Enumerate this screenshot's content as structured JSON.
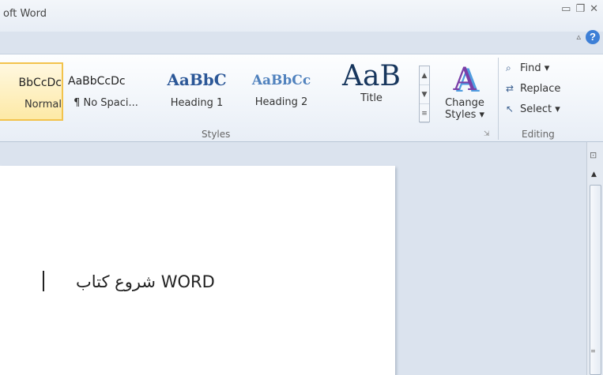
{
  "titlebar": {
    "title": "oft Word",
    "minimize": "▭",
    "restore": "❐",
    "close": "✕",
    "collapse_ribbon": "▵",
    "help": "?"
  },
  "styles": {
    "items": [
      {
        "sample": "BbCcDc",
        "name": "Normal"
      },
      {
        "sample": "AaBbCcDc",
        "name": "¶ No Spaci..."
      },
      {
        "sample": "AaBbC",
        "name": "Heading 1"
      },
      {
        "sample": "AaBbCc",
        "name": "Heading 2"
      },
      {
        "sample": "AaB",
        "name": "Title"
      }
    ],
    "scroll_up": "▲",
    "scroll_down": "▼",
    "more": "≡",
    "change_styles_icon": "A",
    "change_styles_label_1": "Change",
    "change_styles_label_2": "Styles ▾",
    "group_label": "Styles",
    "launcher": "⇲"
  },
  "editing": {
    "find": "Find ▾",
    "replace": "Replace",
    "select": "Select ▾",
    "group_label": "Editing"
  },
  "document": {
    "text": "شروع کتاب WORD"
  },
  "scrollbar": {
    "ruler_toggle": "⊡",
    "up_arrow": "▲",
    "grip": "≡"
  }
}
